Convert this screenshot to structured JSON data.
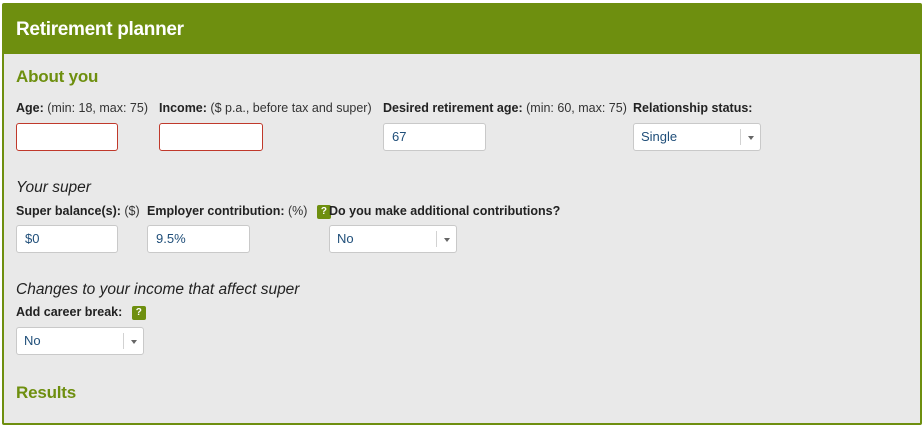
{
  "header": {
    "title": "Retirement planner"
  },
  "about": {
    "title": "About you",
    "age": {
      "label": "Age:",
      "hint": "(min: 18, max: 75)",
      "value": ""
    },
    "income": {
      "label": "Income:",
      "hint": "($ p.a., before tax and super)",
      "value": ""
    },
    "retirement_age": {
      "label": "Desired retirement age:",
      "hint": "(min: 60, max: 75)",
      "value": "67"
    },
    "relationship": {
      "label": "Relationship status:",
      "value": "Single"
    }
  },
  "super": {
    "title": "Your super",
    "balance": {
      "label": "Super balance(s):",
      "hint": "($)",
      "value": "$0"
    },
    "employer": {
      "label": "Employer contribution:",
      "hint": "(%)",
      "value": "9.5%",
      "help": "?"
    },
    "additional": {
      "label": "Do you make additional contributions?",
      "value": "No"
    }
  },
  "changes": {
    "title": "Changes to your income that affect super",
    "career_break": {
      "label": "Add career break:",
      "value": "No",
      "help": "?"
    }
  },
  "results": {
    "title": "Results"
  },
  "colors": {
    "accent": "#6e8f0f",
    "error": "#c0392b",
    "value_text": "#1f4e79",
    "panel_bg": "#e9e9e9"
  }
}
